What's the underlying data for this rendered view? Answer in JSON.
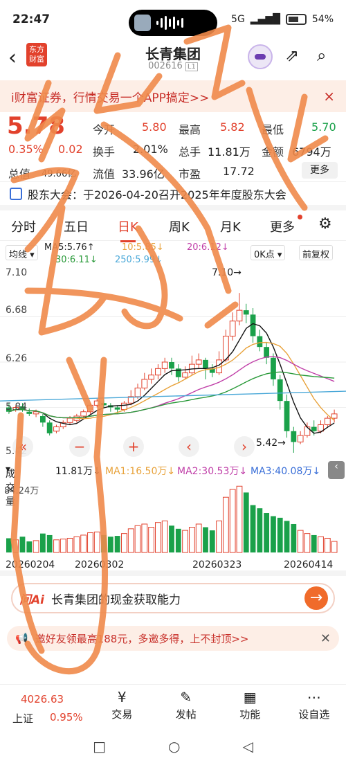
{
  "status": {
    "time": "22:47",
    "network": "5G",
    "battery": "54%"
  },
  "header": {
    "back": "‹",
    "logo": "东方财富",
    "title": "长青集团",
    "code": "002616",
    "code_tag": "L1"
  },
  "banner": {
    "text": "i财富证券，行情交易一个APP搞定>>",
    "close": "×"
  },
  "quote": {
    "price": "5.78",
    "pct": "0.35%",
    "change": "0.02",
    "open_label": "今开",
    "open": "5.80",
    "high_label": "最高",
    "high": "5.82",
    "low_label": "最低",
    "low": "5.70",
    "turnover_label": "换手",
    "turnover": "2.01%",
    "volume_label": "总手",
    "volume": "11.81万",
    "amount_label": "金额",
    "amount": "6794万",
    "mcap_label": "总值",
    "mcap": "49.66亿",
    "float_label": "流值",
    "float": "33.96亿",
    "pe_label": "市盈",
    "pe": "17.72",
    "more": "更多"
  },
  "notice": {
    "text": "股东大会：于2026-04-20召开2025年年度股东大会"
  },
  "tabs": [
    "分时",
    "五日",
    "日K",
    "周K",
    "月K",
    "更多"
  ],
  "ma": {
    "select": "均线",
    "ma5": "MA5:5.76↑",
    "ma10": "10:5.85↓",
    "ma20": "20:6.12↓",
    "ma30": "30:6.11↓",
    "ma250": "250:5.99↓",
    "point_select": "0K点",
    "adjust": "前复权"
  },
  "kline": {
    "y_top": "7.10",
    "y_mid1": "6.68",
    "y_mid2": "6.26",
    "y_mid3": "5.84",
    "y_bottom": "5.42",
    "high_label": "7.10→",
    "low_label": "5.42→"
  },
  "volume_head": {
    "select": "成交量",
    "vol": "11.81万↓",
    "ma1": "MA1:16.50万↓",
    "ma2": "MA2:30.53万↓",
    "ma3": "MA3:40.08万↓",
    "axis": "84.24万"
  },
  "dates": [
    "20260204",
    "20260302",
    "20260323",
    "20260414"
  ],
  "ai": {
    "tag": "问Ai",
    "text": "长青集团的现金获取能力"
  },
  "invite": {
    "text": "邀好友领最高188元，多邀多得，上不封顶>>"
  },
  "bottom": {
    "index_value": "4026.63",
    "index_name": "上证",
    "index_pct": "0.95%",
    "trade": "交易",
    "post": "发帖",
    "function": "功能",
    "settings": "设自选"
  },
  "colors": {
    "up": "#e2412c",
    "down": "#1aa14a",
    "scribble": "#f08a4b"
  }
}
